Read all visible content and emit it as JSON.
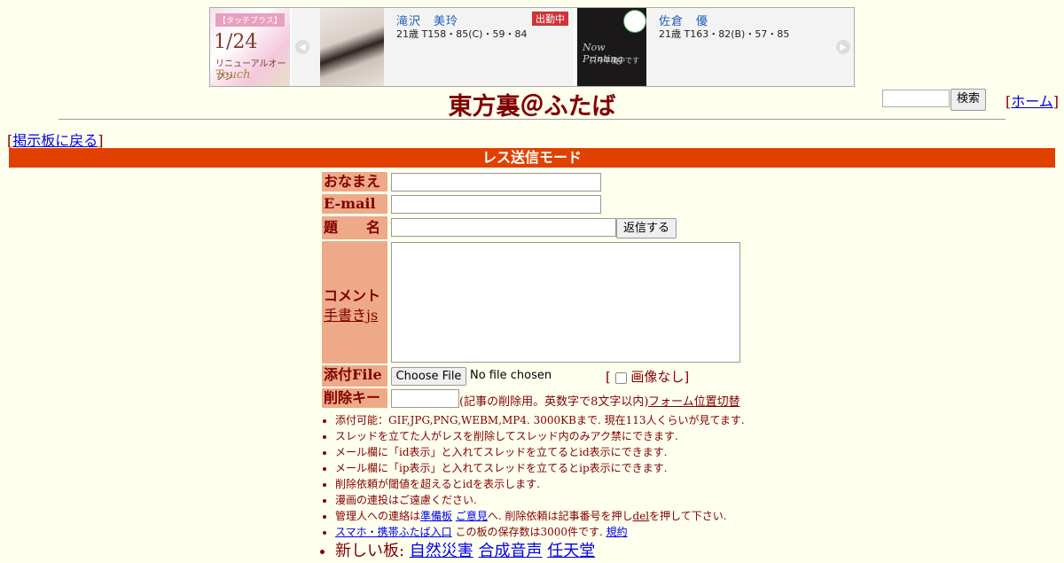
{
  "banner": {
    "ad": {
      "tag": "【タッチプラス】",
      "date": "1/24",
      "line": "リニューアルオープン",
      "brand": "Touch"
    },
    "cards": [
      {
        "name": "滝沢　美玲",
        "stats": "21歳 T158・85(C)・59・84",
        "badge": "出勤中"
      },
      {
        "name": "佐倉　優",
        "stats": "21歳 T163・82(B)・57・85",
        "badge": "",
        "photo_text": "Now Printing",
        "photo_sub": "只今準備中です"
      }
    ],
    "prev_icon": "chevron-left-icon",
    "next_icon": "chevron-right-icon"
  },
  "header": {
    "title": "東方裏＠ふたば",
    "search_button": "検索",
    "home_link": "ホーム"
  },
  "nav": {
    "back_link": "掲示板に戻る"
  },
  "mode_bar": "レス送信モード",
  "form": {
    "name_label": "おなまえ",
    "email_label": "E-mail",
    "subject_label": "題　　名",
    "submit_button": "返信する",
    "comment_label": "コメント",
    "handwrite_link": "手書きjs",
    "file_label": "添付File",
    "file_button": "Choose File",
    "file_status": "No file chosen",
    "no_image_label": "画像なし",
    "delkey_label": "削除キー",
    "delkey_hint": "(記事の削除用。英数字で8文字以内)",
    "form_toggle_link": "フォーム位置切替"
  },
  "notes": {
    "n1": "添付可能：GIF,JPG,PNG,WEBM,MP4. 3000KBまで. 現在113人くらいが見てます.",
    "n2": "スレッドを立てた人がレスを削除してスレッド内のみアク禁にできます.",
    "n3": "メール欄に「id表示」と入れてスレッドを立てるとid表示にできます.",
    "n4": "メール欄に「ip表示」と入れてスレッドを立てるとip表示にできます.",
    "n5": "削除依頼が閾値を超えるとidを表示します.",
    "n6": "漫画の連投はご遠慮ください.",
    "n7_pre": "管理人への連絡は",
    "n7_link1": "準備板",
    "n7_link2": "ご意見",
    "n7_mid": "へ. 削除依頼は記事番号を押し",
    "n7_link3": "del",
    "n7_post": "を押して下さい.",
    "n8_link": "スマホ・携帯ふたば入口",
    "n8_text": " この板の保存数は3000件です.",
    "n8_link2": "規約",
    "new_label": "新しい板: ",
    "new_boards": [
      "自然災害",
      "合成音声",
      "任天堂"
    ]
  }
}
